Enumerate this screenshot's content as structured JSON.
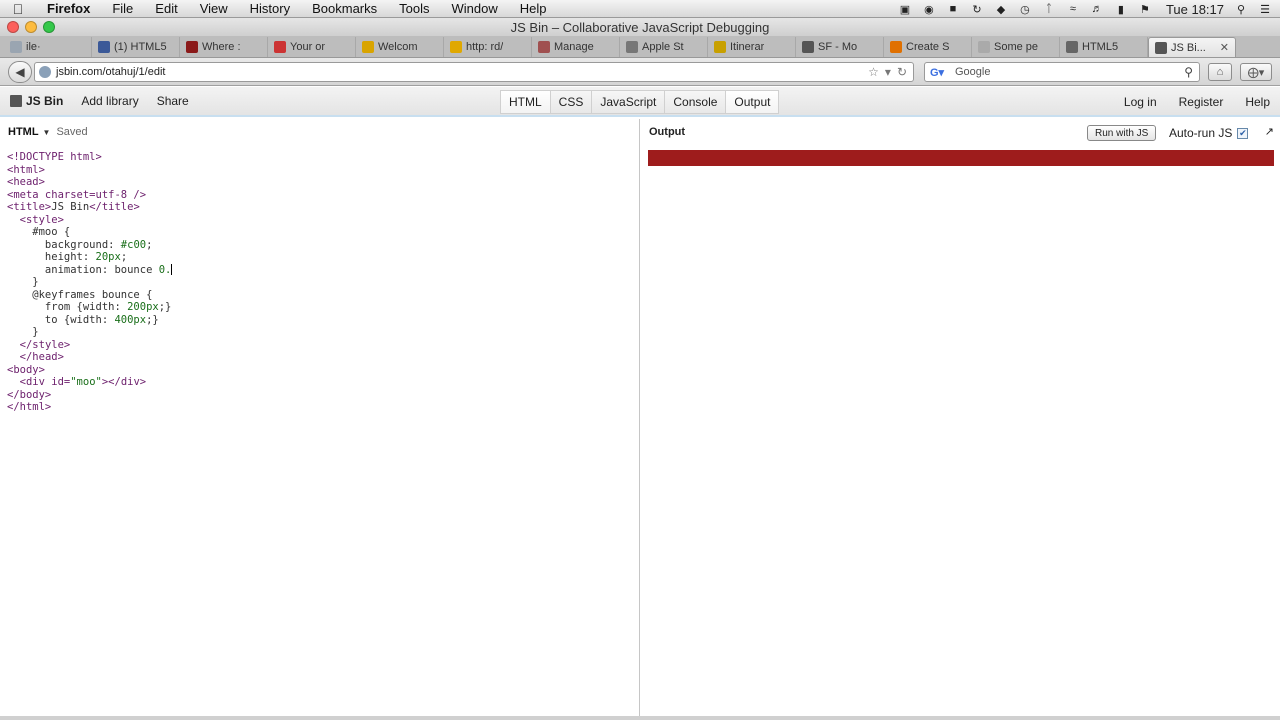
{
  "menubar": {
    "items": [
      "Firefox",
      "File",
      "Edit",
      "View",
      "History",
      "Bookmarks",
      "Tools",
      "Window",
      "Help"
    ],
    "clock": "Tue 18:17"
  },
  "window": {
    "title": "JS Bin – Collaborative JavaScript Debugging"
  },
  "tabs": [
    {
      "label": "ile·",
      "icon_color": "#9aa5b1",
      "active": false
    },
    {
      "label": "(1) HTML5",
      "icon_color": "#3b5998",
      "active": false
    },
    {
      "label": "Where :",
      "icon_color": "#8b1a1a",
      "active": false
    },
    {
      "label": "Your or",
      "icon_color": "#c33",
      "active": false
    },
    {
      "label": "Welcom",
      "icon_color": "#d9a400",
      "active": false
    },
    {
      "label": "http: rd/",
      "icon_color": "#e0a800",
      "active": false
    },
    {
      "label": "Manage",
      "icon_color": "#a05050",
      "active": false
    },
    {
      "label": "Apple St",
      "icon_color": "#777",
      "active": false
    },
    {
      "label": "Itinerar",
      "icon_color": "#c8a000",
      "active": false
    },
    {
      "label": "SF - Mo",
      "icon_color": "#555",
      "active": false
    },
    {
      "label": "Create S",
      "icon_color": "#e07000",
      "active": false
    },
    {
      "label": "Some pe",
      "icon_color": "#aaa",
      "active": false
    },
    {
      "label": "HTML5",
      "icon_color": "#666",
      "active": false
    },
    {
      "label": "JS Bi...",
      "icon_color": "#555",
      "active": true,
      "close": "✕"
    }
  ],
  "nav": {
    "url": "jsbin.com/otahuj/1/edit",
    "search_placeholder": "Google"
  },
  "jsbin": {
    "logo": "JS Bin",
    "add_library": "Add library",
    "share": "Share",
    "panels": [
      "HTML",
      "CSS",
      "JavaScript",
      "Console",
      "Output"
    ],
    "login": "Log in",
    "register": "Register",
    "help": "Help"
  },
  "html_pane": {
    "name": "HTML",
    "status": "Saved",
    "code_lines": [
      "<!DOCTYPE html>",
      "<html>",
      "<head>",
      "<meta charset=utf-8 />",
      "<title>JS Bin</title>",
      "  <style>",
      "    #moo {",
      "      background: #c00;",
      "      height: 20px;",
      "      animation: bounce 0.",
      "    }",
      "    @keyframes bounce {",
      "      from {width: 200px;}",
      "      to {width: 400px;}",
      "    }",
      "  </style>",
      "  </head>",
      "<body>",
      "  <div id=\"moo\"></div>",
      "</body>",
      "</html>"
    ]
  },
  "output_pane": {
    "title": "Output",
    "run_button": "Run with JS",
    "autorun_label": "Auto-run JS",
    "autorun_checked": true,
    "moo_color": "#9e1c1c"
  }
}
